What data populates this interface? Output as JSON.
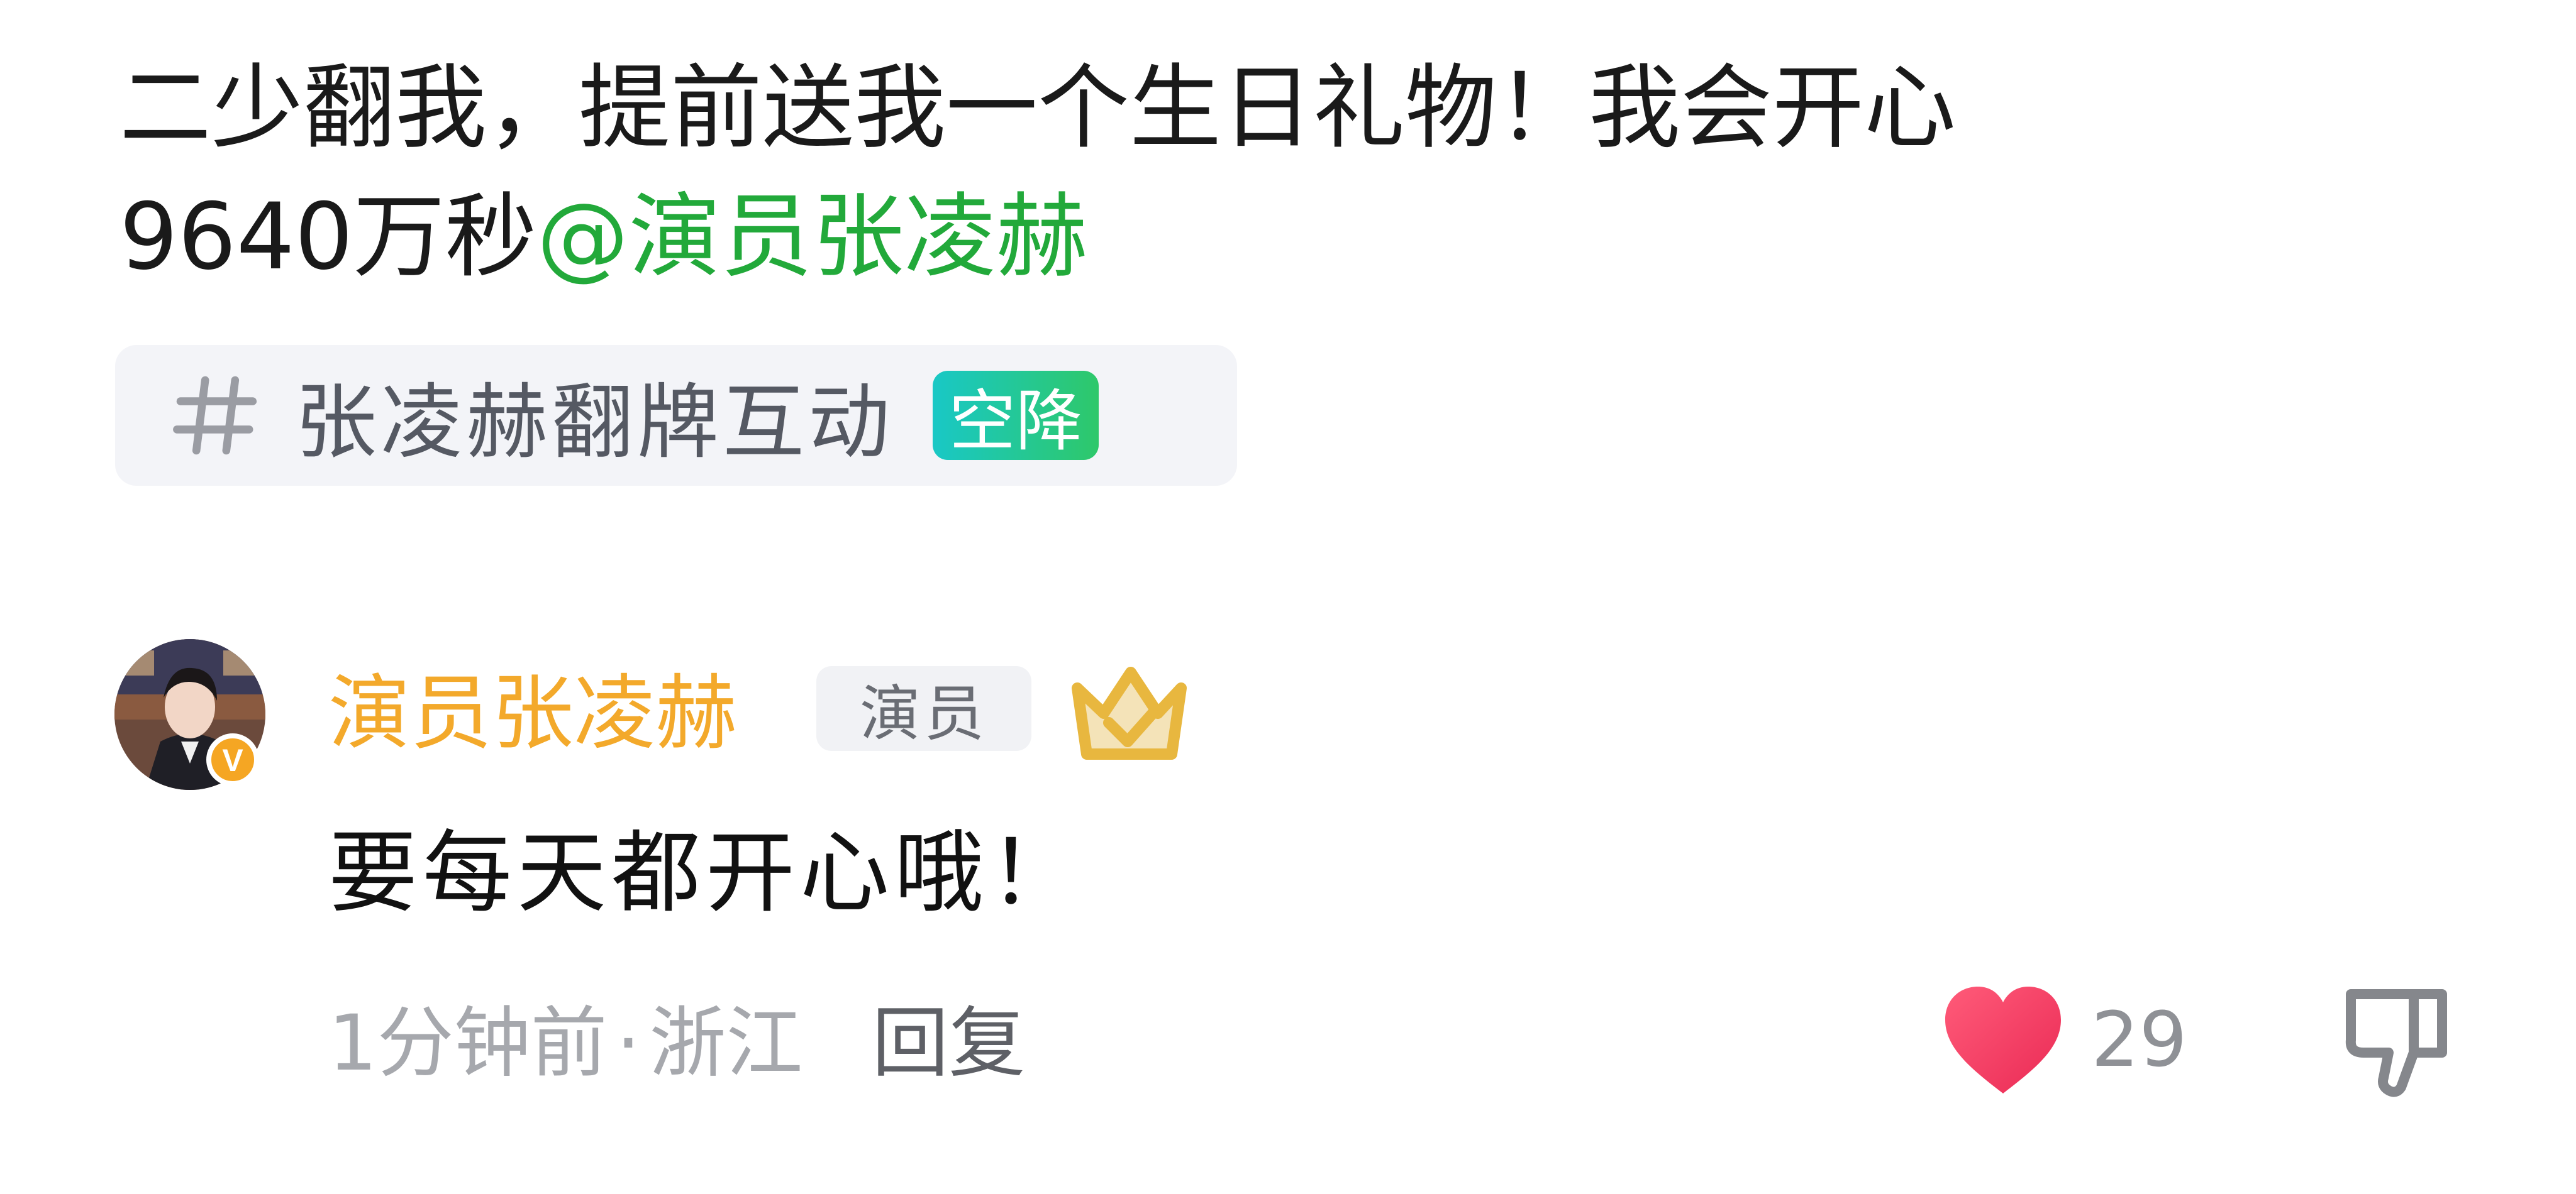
{
  "post": {
    "text_line1": "二少翻我，提前送我一个生日礼物！我会开心",
    "text_line2_prefix": "9640万秒",
    "mention": "@演员张凌赫",
    "topic": {
      "icon": "hash-icon",
      "label": "张凌赫翻牌互动",
      "badge": "空降"
    }
  },
  "comment": {
    "author": "演员张凌赫",
    "role_badge": "演员",
    "verified_mark": "V",
    "body": "要每天都开心哦！",
    "time": "1分钟前",
    "separator": "·",
    "location": "浙江",
    "reply_label": "回复",
    "like_count": "29",
    "liked": true
  },
  "colors": {
    "mention": "#22a93a",
    "author": "#f3a92b",
    "heart": "#f0355e",
    "badge_gradient_start": "#19c8c6",
    "badge_gradient_end": "#2ec86a"
  }
}
